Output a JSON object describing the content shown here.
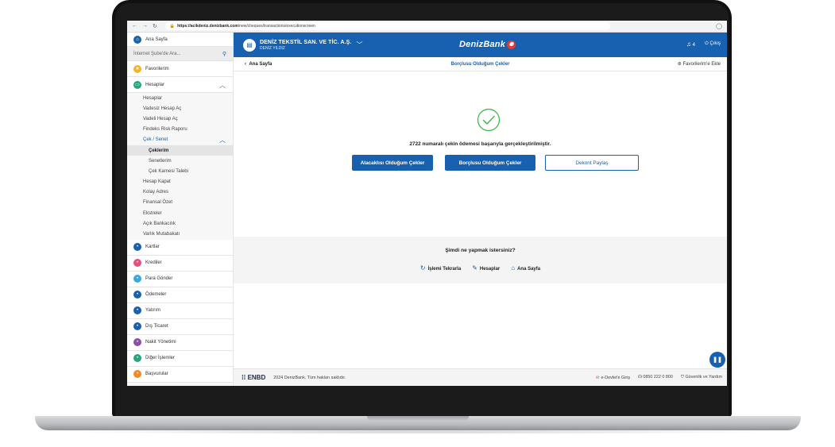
{
  "browser": {
    "url_host": "https://acikdeniz.denizbank.com",
    "url_path": "/new/cheques/transactions/executionscreen"
  },
  "sidebar": {
    "home": "Ana Sayfa",
    "search_placeholder": "İnternet Şube'de Ara...",
    "favorites": "Favorilerim",
    "accounts": "Hesaplar",
    "account_items": [
      "Hesaplar",
      "Vadesiz Hesap Aç",
      "Vadeli Hesap Aç",
      "Findeks Risk Raporu"
    ],
    "cheque_group": "Çek / Senet",
    "cheque_items": [
      "Çeklerim",
      "Senetlerim",
      "Çek Karnesi Talebi"
    ],
    "more_account_items": [
      "Hesap Kapat",
      "Kolay Adres",
      "Finansal Özet",
      "Ekstreler",
      "Açık Bankacılık",
      "Varlık Mutabakatı"
    ],
    "main_items": [
      {
        "label": "Kartlar",
        "icon": "card-icon",
        "color": "#1861b0"
      },
      {
        "label": "Krediler",
        "icon": "loan-icon",
        "color": "#e4527a"
      },
      {
        "label": "Para Gönder",
        "icon": "send-money-icon",
        "color": "#38a9e0"
      },
      {
        "label": "Ödemeler",
        "icon": "payments-icon",
        "color": "#1861b0"
      },
      {
        "label": "Yatırım",
        "icon": "investment-icon",
        "color": "#1861b0"
      },
      {
        "label": "Dış Ticaret",
        "icon": "foreign-trade-icon",
        "color": "#1861b0"
      },
      {
        "label": "Nakit Yönetimi",
        "icon": "cash-management-icon",
        "color": "#8e4fa8"
      },
      {
        "label": "Diğer İşlemler",
        "icon": "other-icon",
        "color": "#2aa57a"
      },
      {
        "label": "Başvurular",
        "icon": "applications-icon",
        "color": "#f08a2b"
      }
    ]
  },
  "topbar": {
    "company": "DENİZ TEKSTİL SAN. VE TİC. A.Ş.",
    "user": "DENİZ YILDIZ",
    "brand": "DenizBank",
    "notif_count": "4",
    "logout": "Çıkış"
  },
  "subbar": {
    "back": "Ana Sayfa",
    "title": "Borçlusu Olduğum Çekler",
    "favorite_add": "Favorilerim'e Ekle"
  },
  "result": {
    "message": "2722 numaralı çekin ödemesi başarıyla gerçekleştirilmiştir.",
    "btn_creditor": "Alacaklısı Olduğum Çekler",
    "btn_debtor": "Borçlusu Olduğum Çekler",
    "btn_share": "Dekont Paylaş"
  },
  "next_steps": {
    "question": "Şimdi ne yapmak istersiniz?",
    "repeat": "İşlemi Tekrarla",
    "accounts": "Hesaplar",
    "home": "Ana Sayfa"
  },
  "footer": {
    "logo": "ENBD",
    "copyright": "2024 DenizBank. Tüm hakları saklıdır.",
    "edevlet": "e-Devlet'e Giriş",
    "phone": "0850 222 0 800",
    "security": "Güvenlik ve Yardım"
  },
  "colors": {
    "brand_blue": "#1861b0",
    "success_green": "#3bb54a"
  }
}
